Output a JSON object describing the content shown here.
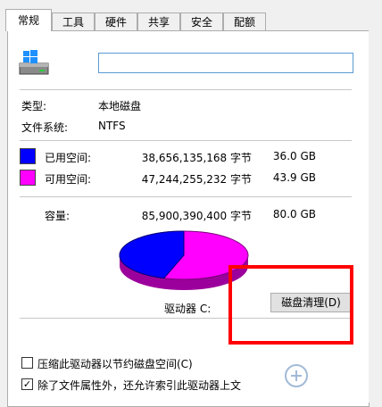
{
  "tabs": [
    "常规",
    "工具",
    "硬件",
    "共享",
    "安全",
    "配额"
  ],
  "name_input": {
    "value": ""
  },
  "info": {
    "type_label": "类型:",
    "type_value": "本地磁盘",
    "fs_label": "文件系统:",
    "fs_value": "NTFS"
  },
  "used": {
    "label": "已用空间:",
    "bytes": "38,656,135,168 字节",
    "size": "36.0 GB",
    "color": "#0000ff"
  },
  "free": {
    "label": "可用空间:",
    "bytes": "47,244,255,232 字节",
    "size": "43.9 GB",
    "color": "#ff00ff"
  },
  "capacity": {
    "label": "容量:",
    "bytes": "85,900,390,400 字节",
    "size": "80.0 GB"
  },
  "drive_label": "驱动器 C:",
  "cleanup_button": "磁盘清理(D)",
  "options": {
    "compress": {
      "label": "压缩此驱动器以节约磁盘空间(C)",
      "checked": false
    },
    "index": {
      "label": "除了文件属性外，还允许索引此驱动器上文",
      "checked": true
    }
  }
}
